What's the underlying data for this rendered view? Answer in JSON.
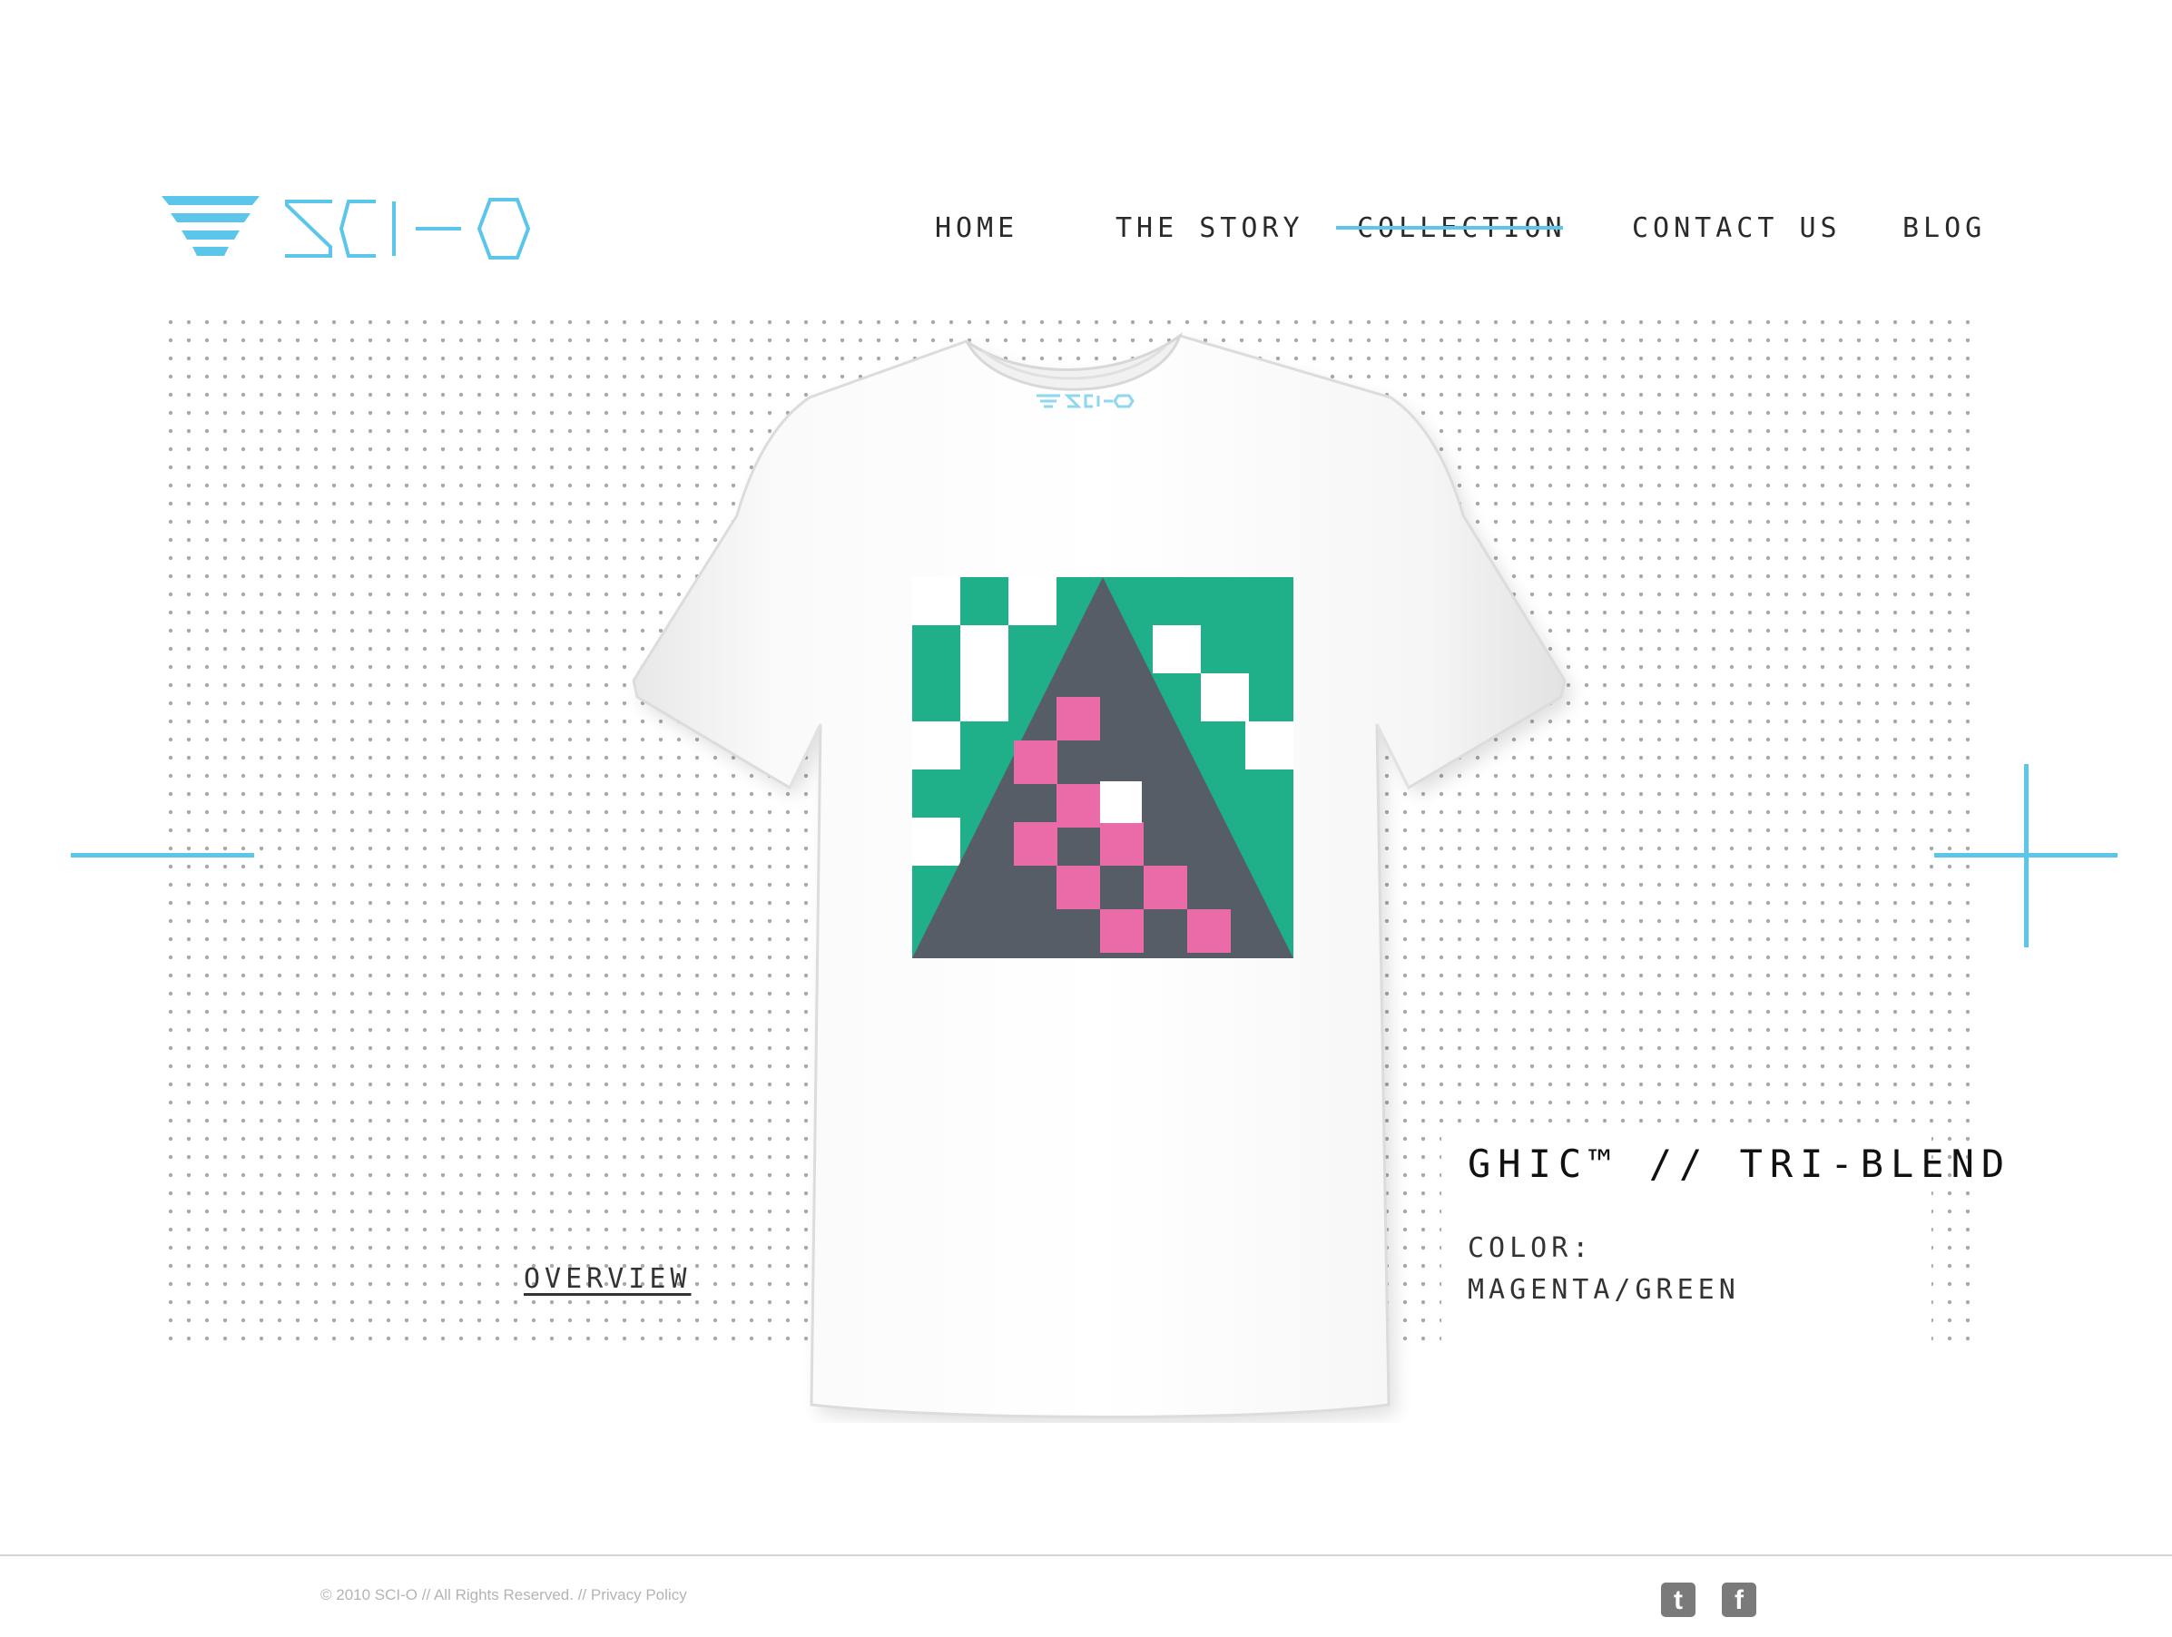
{
  "brand": {
    "name": "SCI-O",
    "accent_color": "#5cc6ea"
  },
  "nav": {
    "items": [
      {
        "label": "HOME"
      },
      {
        "label": "THE STORY"
      },
      {
        "label": "COLLECTION",
        "active": true
      },
      {
        "label": "CONTACT US"
      },
      {
        "label": "BLOG"
      }
    ]
  },
  "product": {
    "title": "GHIC™ // TRI-BLEND",
    "color_label": "COLOR:",
    "color_value": "MAGENTA/GREEN",
    "overview_link": "OVERVIEW",
    "graphic_colors": {
      "green": "#1fb089",
      "slate": "#5a5a66",
      "magenta": "#ea6ba8"
    },
    "collar_print": "SCI-O"
  },
  "footer": {
    "copyright": "© 2010 SCI-O // All Rights Reserved. //",
    "privacy": "Privacy Policy",
    "social": [
      {
        "name": "twitter-icon",
        "glyph": "t"
      },
      {
        "name": "facebook-icon",
        "glyph": "f"
      }
    ]
  }
}
